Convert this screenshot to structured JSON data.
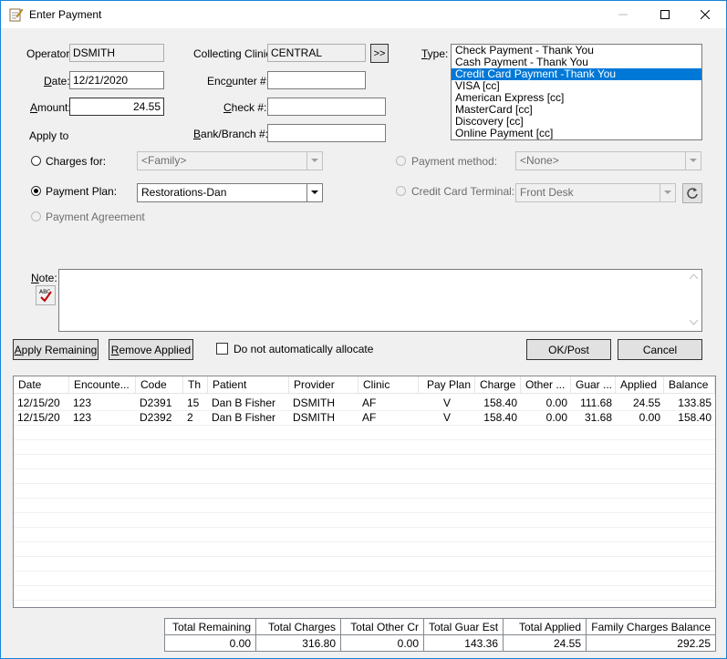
{
  "window": {
    "title": "Enter Payment",
    "accent": "#0078d7"
  },
  "form": {
    "operator_label": "Operator:",
    "operator_value": "DSMITH",
    "date_label": "Date:",
    "date_value": "12/21/2020",
    "amount_label": "Amount:",
    "amount_value": "24.55",
    "apply_to_label": "Apply to",
    "collecting_clinic_label": "Collecting Clinic:",
    "collecting_clinic_value": "CENTRAL",
    "clinic_more_button": ">>",
    "encounter_label": "Encounter #:",
    "encounter_value": "",
    "check_label": "Check #:",
    "check_value": "",
    "bank_label": "Bank/Branch #:",
    "bank_value": "",
    "type_label": "Type:",
    "type_options": [
      "Check Payment - Thank You",
      "Cash Payment - Thank You",
      "Credit Card Payment -Thank You",
      "VISA [cc]",
      "American Express [cc]",
      "MasterCard [cc]",
      "Discovery [cc]",
      "Online Payment [cc]"
    ],
    "type_selected_index": 2,
    "charges_for_label": "Charges for:",
    "charges_for_value": "<Family>",
    "payment_plan_label": "Payment Plan:",
    "payment_plan_value": "Restorations-Dan",
    "payment_agreement_label": "Payment Agreement",
    "payment_method_label": "Payment method:",
    "payment_method_value": "<None>",
    "cc_terminal_label": "Credit Card Terminal:",
    "cc_terminal_value": "Front Desk",
    "note_label": "Note:",
    "note_value": ""
  },
  "actions": {
    "apply_remaining": "Apply Remaining",
    "remove_applied": "Remove Applied",
    "do_not_allocate": "Do not automatically allocate",
    "ok_post": "OK/Post",
    "cancel": "Cancel"
  },
  "grid": {
    "columns": [
      "Date",
      "Encounte...",
      "Code",
      "Th",
      "Patient",
      "Provider",
      "Clinic",
      "Pay Plan",
      "Charge",
      "Other ...",
      "Guar ...",
      "Applied",
      "Balance"
    ],
    "rows": [
      [
        "12/15/20",
        "123",
        "D2391",
        "15",
        "Dan B Fisher",
        "DSMITH",
        "AF",
        "V",
        "158.40",
        "0.00",
        "111.68",
        "24.55",
        "133.85"
      ],
      [
        "12/15/20",
        "123",
        "D2392",
        "2",
        "Dan B Fisher",
        "DSMITH",
        "AF",
        "V",
        "158.40",
        "0.00",
        "31.68",
        "0.00",
        "158.40"
      ]
    ]
  },
  "totals": {
    "headers": [
      "Total Remaining",
      "Total Charges",
      "Total Other Cr",
      "Total Guar Est",
      "Total Applied",
      "Family Charges Balance"
    ],
    "values": [
      "0.00",
      "316.80",
      "0.00",
      "143.36",
      "24.55",
      "292.25"
    ]
  }
}
